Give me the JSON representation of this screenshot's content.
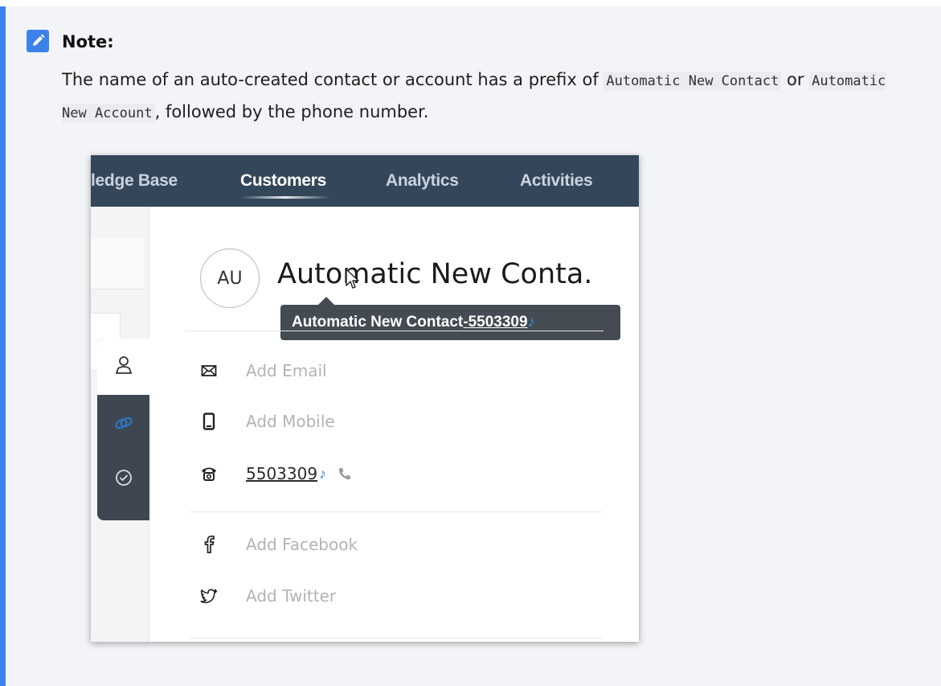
{
  "note": {
    "title": "Note:",
    "text_part1": "The name of an auto-created contact or account has a prefix of ",
    "code1": "Automatic New Contact",
    "text_part2": " or ",
    "code2": "Automatic New Account",
    "text_part3": ", followed by the phone number."
  },
  "nav": {
    "items": [
      "ledge Base",
      "Customers",
      "Analytics",
      "Activities"
    ],
    "active": "Customers"
  },
  "contact": {
    "initials": "AU",
    "name_display": "Automatic New Conta.",
    "tooltip_name": "Automatic New Contact",
    "tooltip_phone": "-5503309",
    "phone": "5503309"
  },
  "fields": {
    "email": "Add Email",
    "mobile": "Add Mobile",
    "facebook": "Add Facebook",
    "twitter": "Add Twitter"
  },
  "colors": {
    "accent": "#3d82ea",
    "nav_bg": "#34475a",
    "tooltip_bg": "#444b52",
    "phone_blue": "#2f8de4"
  },
  "icons": [
    "edit-icon",
    "contact-person-icon",
    "linked-icon",
    "check-circle-icon",
    "email-icon",
    "mobile-icon",
    "telephone-icon",
    "call-icon",
    "facebook-icon",
    "twitter-icon",
    "mouse-cursor-icon"
  ]
}
